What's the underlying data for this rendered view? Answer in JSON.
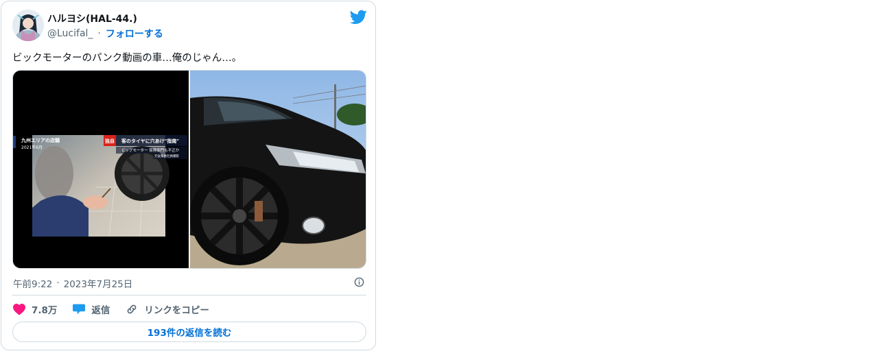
{
  "author": {
    "display_name": "ハルヨシ(HAL-44.)",
    "handle": "@Lucifal_",
    "separator": "·",
    "follow_label": "フォローする",
    "avatar_icon": "user-avatar-icon"
  },
  "brand": {
    "icon": "twitter-bird-icon",
    "color": "#1d9bf0"
  },
  "tweet": {
    "text": "ビックモーターのパンク動画の車…俺のじゃん…。"
  },
  "media": {
    "left": {
      "caption_location": "九州エリアの店舗",
      "caption_date": "2021年6月",
      "badge": "独自",
      "headline": "客のタイヤに穴あけ\"指南\"",
      "subline": "ビッグモーター 保険部門も不正か",
      "credit": "元従業員社員撮影"
    }
  },
  "timestamp": {
    "time": "午前9:22",
    "separator": "·",
    "date": "2023年7月25日",
    "info_icon": "info-icon"
  },
  "actions": {
    "like_count": "7.8万",
    "reply_label": "返信",
    "copy_link_label": "リンクをコピー"
  },
  "read_replies": {
    "label": "193件の返信を読む"
  },
  "colors": {
    "like": "#f91880",
    "reply": "#1d9bf0",
    "link": "#006fd6",
    "muted": "#536471"
  }
}
